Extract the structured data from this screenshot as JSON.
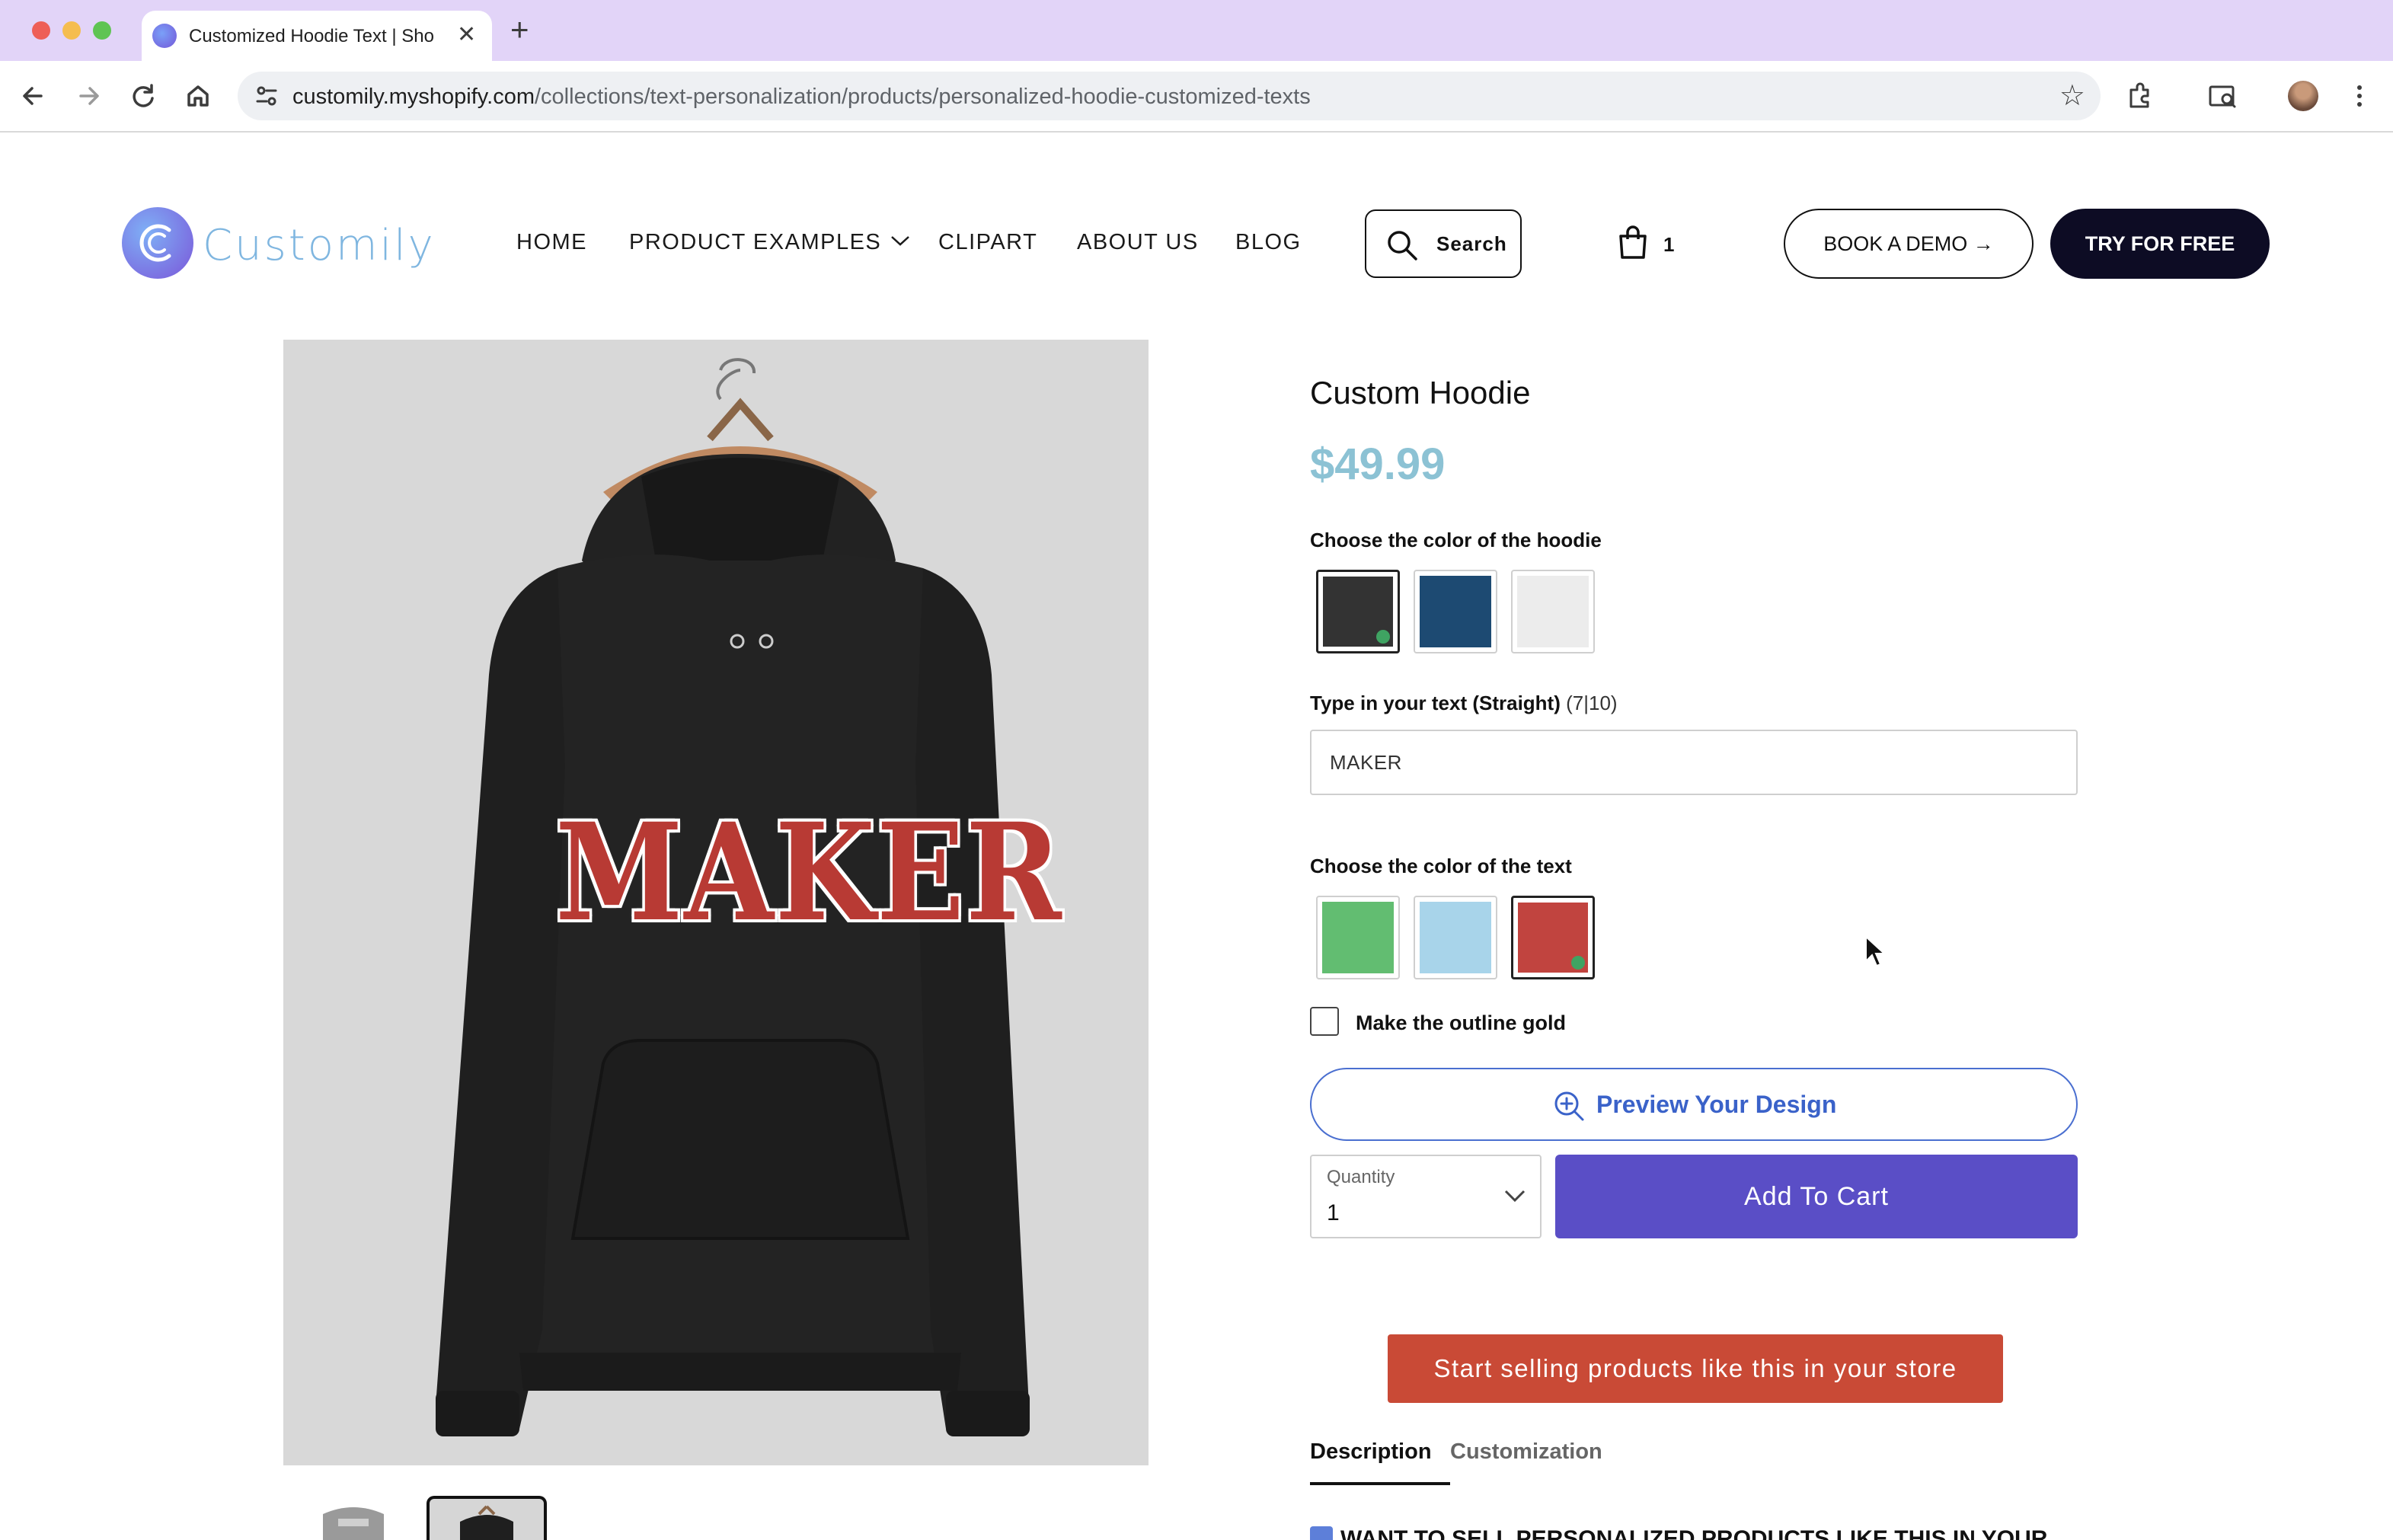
{
  "browser": {
    "tab_title": "Customized Hoodie Text | Sho",
    "url_domain": "customily.myshopify.com",
    "url_path": "/collections/text-personalization/products/personalized-hoodie-customized-texts"
  },
  "header": {
    "logo_text": "Customily",
    "nav": [
      "HOME",
      "PRODUCT EXAMPLES",
      "CLIPART",
      "ABOUT US",
      "BLOG"
    ],
    "search_label": "Search",
    "cart_count": "1",
    "book_demo": "BOOK A DEMO →",
    "try_free": "TRY FOR FREE"
  },
  "product": {
    "hoodie_print_text": "MAKER",
    "title": "Custom Hoodie",
    "price": "$49.99",
    "hoodie_color_label": "Choose the color of the hoodie",
    "hoodie_colors": [
      {
        "name": "black",
        "hex": "#333333",
        "selected": true
      },
      {
        "name": "navy",
        "hex": "#1d4a72",
        "selected": false
      },
      {
        "name": "white",
        "hex": "#ececec",
        "selected": false
      }
    ],
    "text_label": "Type in your text (Straight)",
    "text_counter": "(7|10)",
    "text_value": "MAKER",
    "text_color_label": "Choose the color of the text",
    "text_colors": [
      {
        "name": "green",
        "hex": "#62bd71",
        "selected": false
      },
      {
        "name": "light-blue",
        "hex": "#a8d4ea",
        "selected": false
      },
      {
        "name": "red",
        "hex": "#c1443f",
        "selected": true
      }
    ],
    "outline_label": "Make the outline gold",
    "outline_checked": false,
    "preview_label": "Preview Your Design",
    "quantity_caption": "Quantity",
    "quantity_value": "1",
    "add_to_cart": "Add To Cart",
    "sell_cta": "Start selling products like this in your store",
    "tabs": [
      "Description",
      "Customization"
    ],
    "description_first_line": "WANT TO SELL PERSONALIZED PRODUCTS LIKE THIS IN YOUR"
  },
  "colors": {
    "accent_blue": "#3a62c9",
    "cart_button": "#5a4ec6",
    "cta_red": "#c94a36",
    "price": "#8cc2d4"
  }
}
